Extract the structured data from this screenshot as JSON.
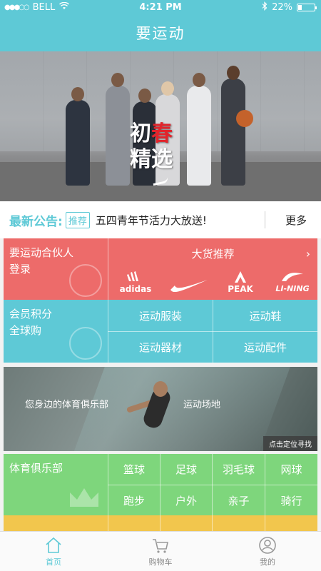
{
  "status_bar": {
    "carrier": "BELL",
    "time": "4:21 PM",
    "battery": "22%",
    "battery_level": 0.22
  },
  "nav": {
    "title": "要运动"
  },
  "banner": {
    "title_line1_a": "初",
    "title_line1_b": "春",
    "title_line2": "精选"
  },
  "notice": {
    "title": "最新公告:",
    "tag": "推荐",
    "text": "五四青年节活力大放送!",
    "more": "更多"
  },
  "partner": {
    "line1": "要运动合伙人",
    "line2": "登录"
  },
  "hot_goods": {
    "title": "大货推荐",
    "brands": [
      "adidas",
      "NIKE",
      "PEAK",
      "LI-NING"
    ]
  },
  "member": {
    "line1": "会员积分",
    "line2": "全球购"
  },
  "categories": [
    "运动服装",
    "运动鞋",
    "运动器材",
    "运动配件"
  ],
  "club_banner": {
    "text_left": "您身边的体育俱乐部",
    "text_right": "运动场地",
    "locate": "点击定位寻找"
  },
  "club": {
    "title": "体育俱乐部",
    "sports": [
      "篮球",
      "足球",
      "羽毛球",
      "网球",
      "跑步",
      "户外",
      "亲子",
      "骑行"
    ]
  },
  "tabbar": {
    "items": [
      "首页",
      "购物车",
      "我的"
    ]
  },
  "colors": {
    "accent": "#5ec9d6",
    "red": "#ed6b6a",
    "green": "#7ed67c",
    "yellow": "#f2c64d"
  }
}
